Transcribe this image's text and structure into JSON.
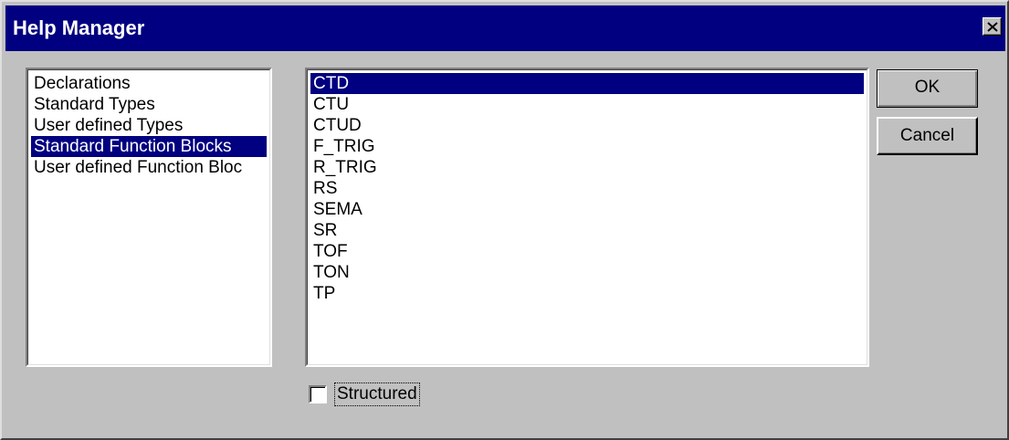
{
  "window": {
    "title": "Help Manager",
    "close_icon": "close-icon"
  },
  "categories": [
    {
      "label": "Declarations",
      "selected": false
    },
    {
      "label": "Standard Types",
      "selected": false
    },
    {
      "label": "User defined Types",
      "selected": false
    },
    {
      "label": "Standard Function Blocks",
      "selected": true
    },
    {
      "label": "User defined Function Bloc",
      "selected": false
    }
  ],
  "items": [
    {
      "label": "CTD",
      "selected": true
    },
    {
      "label": "CTU",
      "selected": false
    },
    {
      "label": "CTUD",
      "selected": false
    },
    {
      "label": "F_TRIG",
      "selected": false
    },
    {
      "label": "R_TRIG",
      "selected": false
    },
    {
      "label": "RS",
      "selected": false
    },
    {
      "label": "SEMA",
      "selected": false
    },
    {
      "label": "SR",
      "selected": false
    },
    {
      "label": "TOF",
      "selected": false
    },
    {
      "label": "TON",
      "selected": false
    },
    {
      "label": "TP",
      "selected": false
    }
  ],
  "buttons": {
    "ok_label": "OK",
    "cancel_label": "Cancel"
  },
  "structured": {
    "label": "Structured",
    "checked": false
  },
  "colors": {
    "titlebar": "#000080",
    "selection": "#000080",
    "face": "#c0c0c0"
  }
}
